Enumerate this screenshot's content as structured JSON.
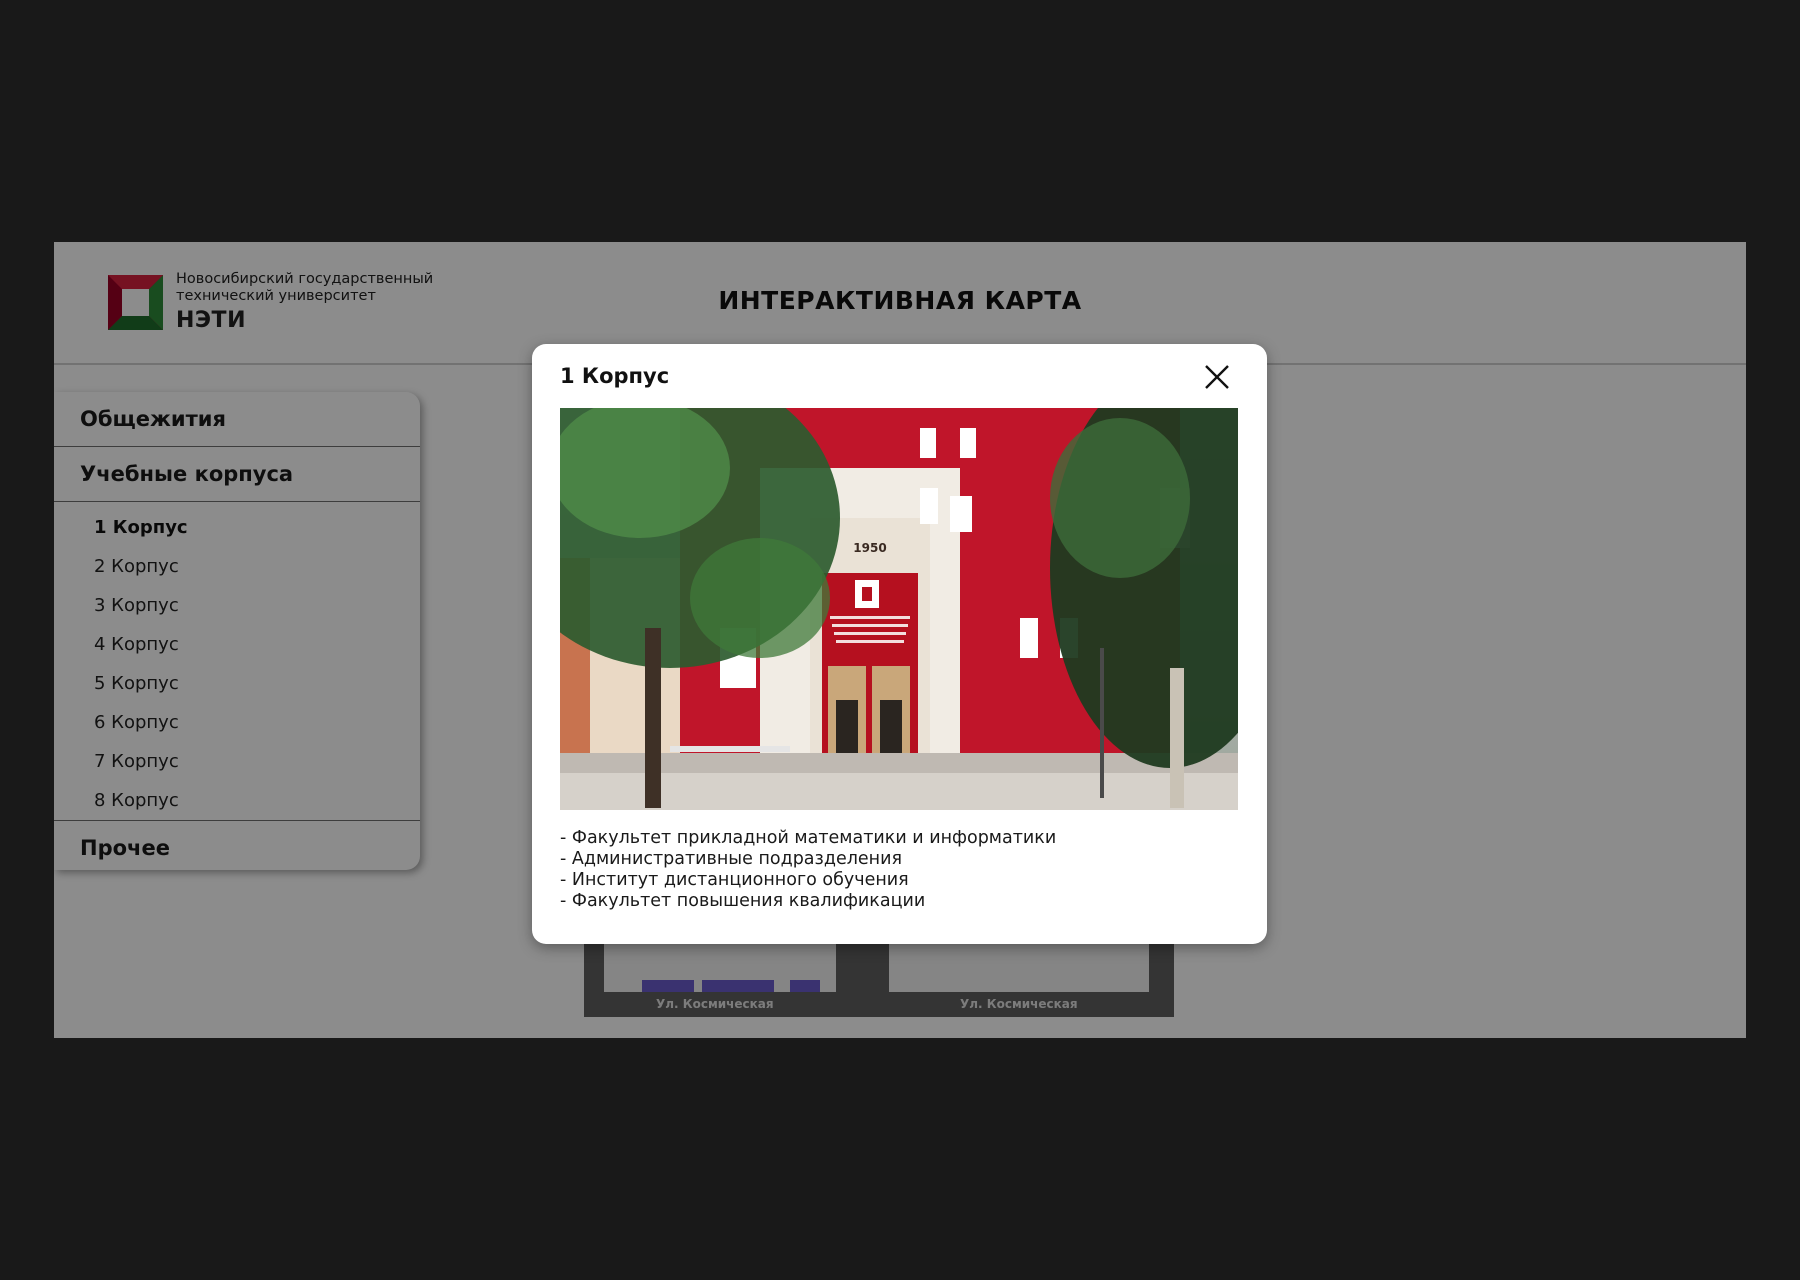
{
  "header": {
    "logo_line1": "Новосибирский государственный",
    "logo_line2": "технический университет",
    "logo_abbr": "НЭТИ",
    "page_title": "ИНТЕРАКТИВНАЯ КАРТА"
  },
  "sidebar": {
    "categories": [
      {
        "label": "Общежития"
      },
      {
        "label": "Учебные корпуса"
      },
      {
        "label": "Прочее"
      }
    ],
    "buildings": [
      {
        "label": "1 Корпус"
      },
      {
        "label": "2 Корпус"
      },
      {
        "label": "3 Корпус"
      },
      {
        "label": "4 Корпус"
      },
      {
        "label": "5 Корпус"
      },
      {
        "label": "6 Корпус"
      },
      {
        "label": "7 Корпус"
      },
      {
        "label": "8 Корпус"
      }
    ]
  },
  "map": {
    "street_left": "Ул. Космическая",
    "street_right": "Ул. Космическая"
  },
  "modal": {
    "title": "1 Корпус",
    "photo_year": "1950",
    "description": [
      "- Факультет прикладной математики и информатики",
      "- Административные подразделения",
      "- Институт дистанционного обучения",
      "- Факультет повышения квалификации"
    ]
  },
  "colors": {
    "brand_red": "#c3002f",
    "brand_green": "#2e8b3a",
    "backdrop": "#191919",
    "overlay": "rgba(0,0,0,0.45)",
    "map_building": "#6a5ccc"
  },
  "icons": {
    "close": "close-icon",
    "logo": "neti-logo-icon"
  }
}
